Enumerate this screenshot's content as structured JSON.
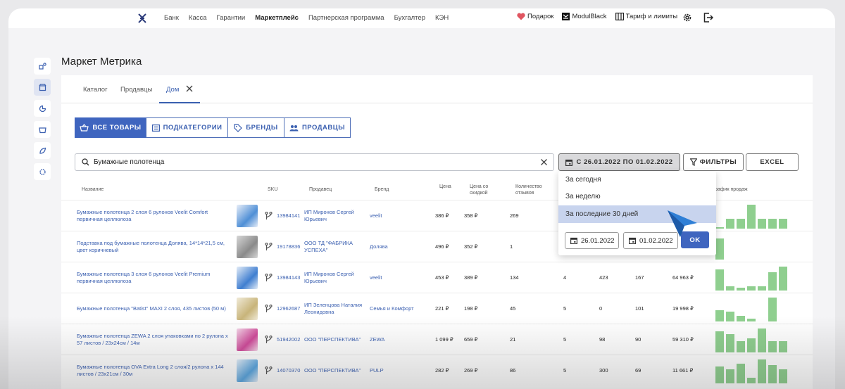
{
  "topnav": {
    "items": [
      "Банк",
      "Касса",
      "Гарантии",
      "Маркетплейс",
      "Партнерская программа",
      "Бухгалтер",
      "КЭН"
    ],
    "active": "Маркетплейс",
    "gift": "Подарок",
    "modul_black": "ModulBlack",
    "tariff": "Тариф и лимиты"
  },
  "page": {
    "title": "Маркет Метрика"
  },
  "tabs": [
    {
      "label": "Каталог"
    },
    {
      "label": "Продавцы"
    },
    {
      "label": "Дом"
    }
  ],
  "segments": [
    {
      "label": "ВСЕ ТОВАРЫ",
      "icon": "basket-icon"
    },
    {
      "label": "ПОДКАТЕГОРИИ",
      "icon": "list-icon"
    },
    {
      "label": "БРЕНДЫ",
      "icon": "tag-icon"
    },
    {
      "label": "ПРОДАВЦЫ",
      "icon": "people-icon"
    }
  ],
  "search": {
    "value": "Бумажные полотенца"
  },
  "toolbar": {
    "date_range": "С 26.01.2022 ПО 01.02.2022",
    "filters": "ФИЛЬТРЫ",
    "excel": "EXCEL"
  },
  "columns": {
    "name": "Название",
    "sku": "SKU",
    "seller": "Продавец",
    "brand": "Бренд",
    "price": "Цена",
    "price_discount_1": "Цена со",
    "price_discount_2": "скидкой",
    "reviews_1": "Количество",
    "reviews_2": "отзывов",
    "chart": "рафик продаж"
  },
  "rows": [
    {
      "name_1": "Бумажные полотенца 2 слоя 6 рулонов Veelit Comfort",
      "name_2": "первичная целлюлоза",
      "sku": "13984141",
      "seller_1": "ИП Миронов Сергей",
      "seller_2": "Юрьевич",
      "brand": "veelit",
      "price": "386 ₽",
      "discount": "358 ₽",
      "reviews": "269",
      "c1": "",
      "c2": "",
      "c3": "",
      "revenue": "",
      "bars": [
        2,
        14,
        14,
        34,
        14,
        14,
        14
      ]
    },
    {
      "name_1": "Подставка под бумажные полотенца Долява, 14*14*21,5 см,",
      "name_2": "цвет коричневый",
      "sku": "19178836",
      "seller_1": "ООО ТД \"ФАБРИКА",
      "seller_2": "УСПЕХА\"",
      "brand": "Долява",
      "price": "496 ₽",
      "discount": "352 ₽",
      "reviews": "1",
      "c1": "",
      "c2": "",
      "c3": "",
      "revenue": "",
      "bars": [
        30,
        0,
        0,
        0,
        0,
        0,
        0
      ]
    },
    {
      "name_1": "Бумажные полотенца 3 слоя 6 рулонов Veelit Premium",
      "name_2": "первичная целлюлоза",
      "sku": "13984143",
      "seller_1": "ИП Миронов Сергей",
      "seller_2": "Юрьевич",
      "brand": "veelit",
      "price": "453 ₽",
      "discount": "389 ₽",
      "reviews": "134",
      "c1": "4",
      "c2": "423",
      "c3": "167",
      "revenue": "64 963 ₽",
      "bars": [
        30,
        6,
        4,
        6,
        6,
        26,
        34
      ]
    },
    {
      "name_1": "Бумажные полотенца \"Batist\" MAXI 2 слоя, 435 листов (50 м)",
      "name_2": "",
      "sku": "12962687",
      "seller_1": "ИП Зеленцова Наталия",
      "seller_2": "Леонидовна",
      "brand": "Семья и Комфорт",
      "price": "221 ₽",
      "discount": "198 ₽",
      "reviews": "45",
      "c1": "5",
      "c2": "0",
      "c3": "101",
      "revenue": "19 998 ₽",
      "bars": [
        16,
        14,
        8,
        4,
        0,
        34,
        0
      ]
    },
    {
      "name_1": "Бумажные полотенца ZEWA 2 слоя упаковками по 2 рулона х",
      "name_2": "57 листов / 23x24см / 14м",
      "sku": "51942002",
      "seller_1": "ООО \"ПЕРСПЕКТИВА\"",
      "seller_2": "",
      "brand": "ZEWA",
      "price": "1 099 ₽",
      "discount": "659 ₽",
      "reviews": "21",
      "c1": "5",
      "c2": "98",
      "c3": "90",
      "revenue": "59 310 ₽",
      "bars": [
        30,
        26,
        16,
        20,
        34,
        16,
        16
      ]
    },
    {
      "name_1": "Бумажные полотенца OVA Extra Long 2 слоя/2 рулона х 144",
      "name_2": "листов / 23x21см / 30м",
      "sku": "14070370",
      "seller_1": "ООО \"ПЕРСПЕКТИВА\"",
      "seller_2": "",
      "brand": "PULP",
      "price": "282 ₽",
      "discount": "269 ₽",
      "reviews": "86",
      "c1": "5",
      "c2": "300",
      "c3": "69",
      "revenue": "11 661 ₽",
      "bars": [
        24,
        20,
        28,
        8,
        34,
        26,
        20
      ]
    }
  ],
  "dropdown": {
    "options": [
      "За сегодня",
      "За неделю",
      "За последние 30 дней"
    ],
    "selected": "За последние 30 дней",
    "date_from": "26.01.2022",
    "date_to": "01.02.2022",
    "ok": "OK"
  },
  "colors": {
    "accent": "#3f65bf",
    "bar": "#8fcf8f",
    "selected": "#c8d4ee"
  }
}
